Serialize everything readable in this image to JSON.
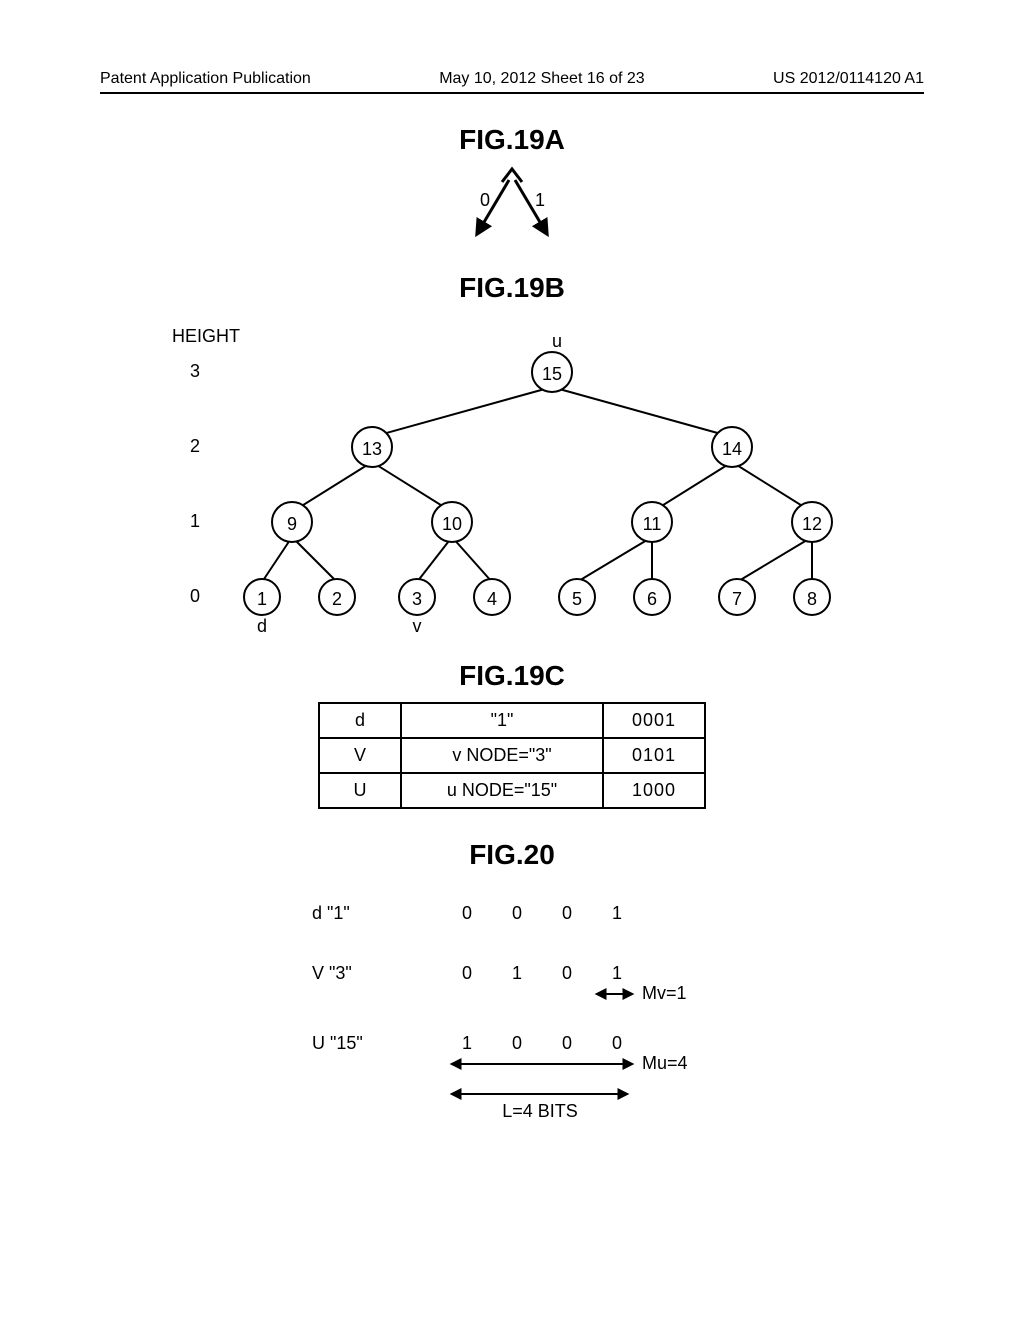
{
  "header": {
    "left": "Patent Application Publication",
    "center": "May 10, 2012  Sheet 16 of 23",
    "right": "US 2012/0114120 A1"
  },
  "fig19a": {
    "title": "FIG.19A",
    "left_label": "0",
    "right_label": "1"
  },
  "fig19b": {
    "title": "FIG.19B",
    "height_label": "HEIGHT",
    "heights": [
      "3",
      "2",
      "1",
      "0"
    ],
    "u_label": "u",
    "d_label": "d",
    "v_label": "v",
    "nodes": {
      "root": "15",
      "l2": [
        "13",
        "14"
      ],
      "l1": [
        "9",
        "10",
        "11",
        "12"
      ],
      "l0": [
        "1",
        "2",
        "3",
        "4",
        "5",
        "6",
        "7",
        "8"
      ]
    }
  },
  "fig19c": {
    "title": "FIG.19C",
    "rows": [
      {
        "a": "d",
        "b": "\"1\"",
        "c": "0001"
      },
      {
        "a": "V",
        "b": "v NODE=\"3\"",
        "c": "0101"
      },
      {
        "a": "U",
        "b": "u NODE=\"15\"",
        "c": "1000"
      }
    ]
  },
  "fig20": {
    "title": "FIG.20",
    "rows": [
      {
        "label": "d \"1\"",
        "bits": [
          "0",
          "0",
          "0",
          "1"
        ],
        "note": ""
      },
      {
        "label": "V \"3\"",
        "bits": [
          "0",
          "1",
          "0",
          "1"
        ],
        "note": "Mv=1"
      },
      {
        "label": "U \"15\"",
        "bits": [
          "1",
          "0",
          "0",
          "0"
        ],
        "note": "Mu=4"
      }
    ],
    "l_label": "L=4 BITS"
  },
  "chart_data": [
    {
      "type": "table",
      "title": "FIG.19C node encoding",
      "data": [
        {
          "symbol": "d",
          "description": "\"1\"",
          "bits": "0001"
        },
        {
          "symbol": "V",
          "description": "v NODE=\"3\"",
          "bits": "0101"
        },
        {
          "symbol": "U",
          "description": "u NODE=\"15\"",
          "bits": "1000"
        }
      ]
    },
    {
      "type": "table",
      "title": "FIG.20 bit layout",
      "data": [
        {
          "symbol": "d \"1\"",
          "bits": [
            0,
            0,
            0,
            1
          ],
          "M": null
        },
        {
          "symbol": "V \"3\"",
          "bits": [
            0,
            1,
            0,
            1
          ],
          "M": 1
        },
        {
          "symbol": "U \"15\"",
          "bits": [
            1,
            0,
            0,
            0
          ],
          "M": 4
        }
      ],
      "L": 4
    }
  ]
}
